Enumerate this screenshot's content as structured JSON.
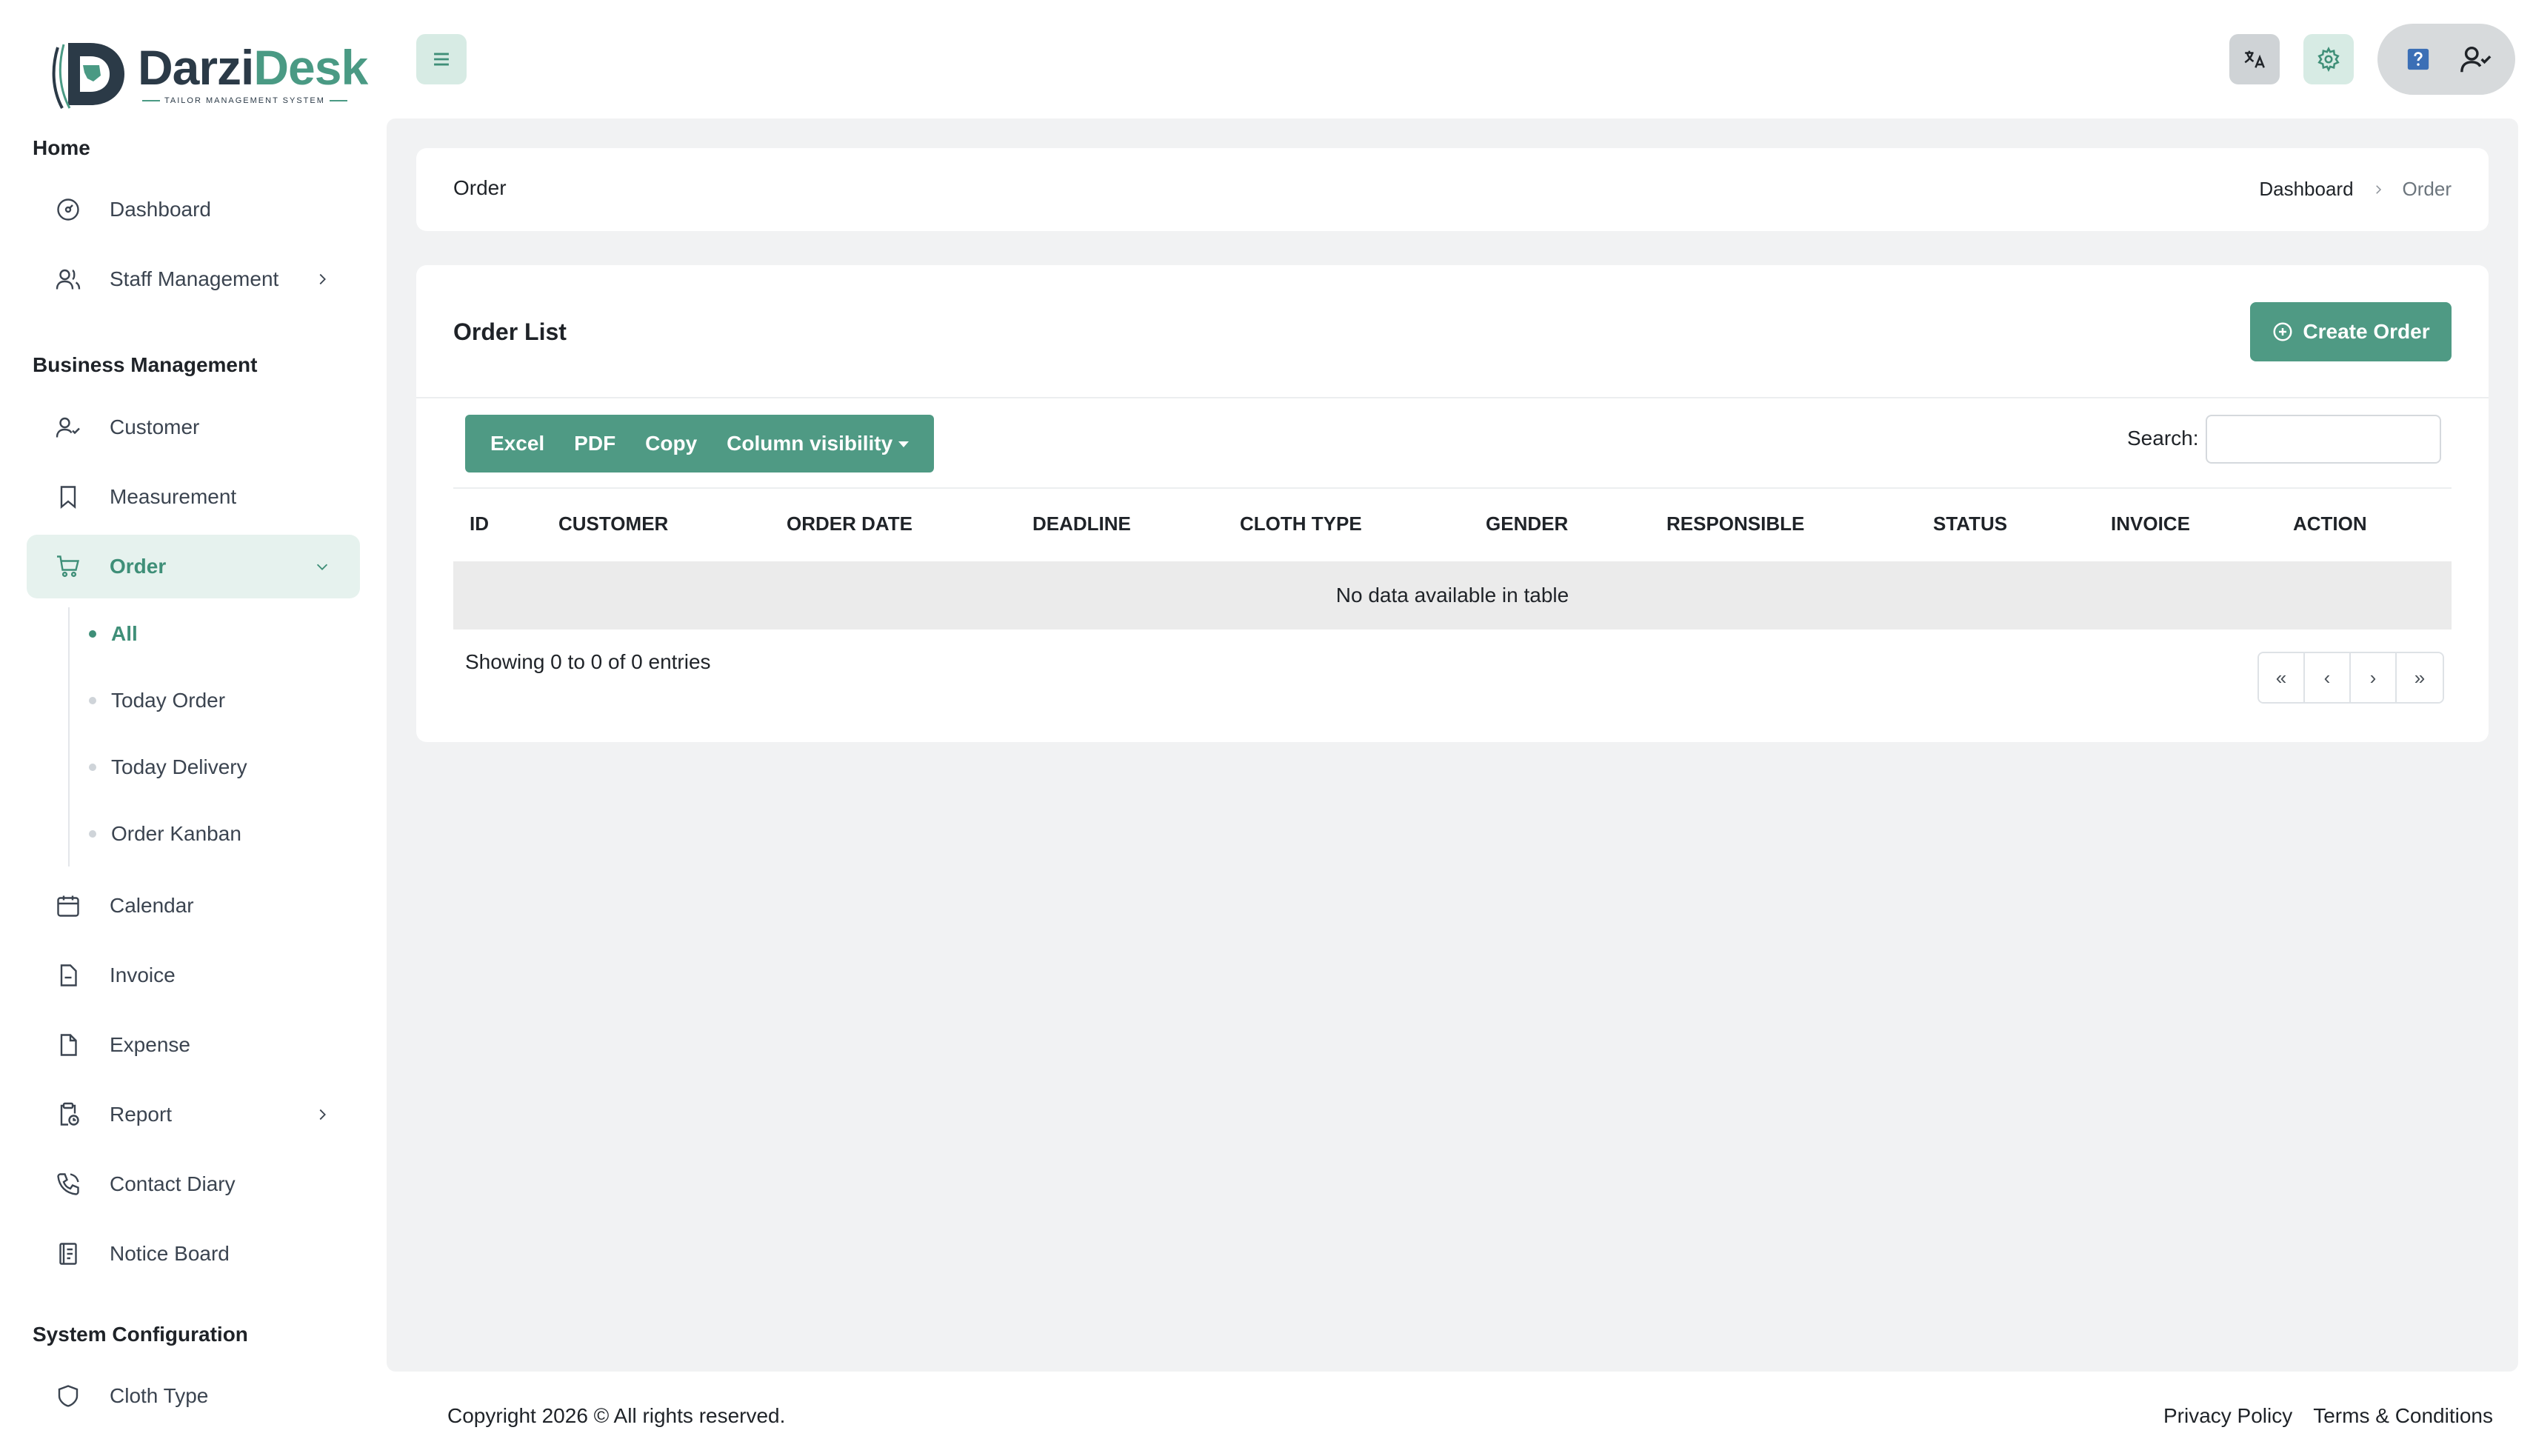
{
  "brand": {
    "word_a": "Darzi",
    "word_b": "Desk",
    "tagline": "TAILOR MANAGEMENT SYSTEM"
  },
  "sidebar": {
    "sections": [
      {
        "title": "Home"
      },
      {
        "title": "Business Management"
      },
      {
        "title": "System Configuration"
      }
    ],
    "items": {
      "dashboard": "Dashboard",
      "staff": "Staff Management",
      "customer": "Customer",
      "measurement": "Measurement",
      "order": "Order",
      "calendar": "Calendar",
      "invoice": "Invoice",
      "expense": "Expense",
      "report": "Report",
      "contact_diary": "Contact Diary",
      "notice_board": "Notice Board",
      "cloth_type": "Cloth Type"
    },
    "order_sub": [
      "All",
      "Today Order",
      "Today Delivery",
      "Order Kanban"
    ]
  },
  "header": {
    "page_title": "Order",
    "breadcrumb": [
      "Dashboard",
      "Order"
    ]
  },
  "order_list": {
    "title": "Order List",
    "create_label": "Create Order",
    "toolbar": [
      "Excel",
      "PDF",
      "Copy",
      "Column visibility"
    ],
    "search_label": "Search:",
    "search_value": "",
    "columns": [
      "ID",
      "CUSTOMER",
      "ORDER DATE",
      "DEADLINE",
      "CLOTH TYPE",
      "GENDER",
      "RESPONSIBLE",
      "STATUS",
      "INVOICE",
      "ACTION"
    ],
    "empty_text": "No data available in table",
    "info_text": "Showing 0 to 0 of 0 entries",
    "pager": [
      "«",
      "‹",
      "›",
      "»"
    ]
  },
  "footer": {
    "copyright": "Copyright 2026 © All rights reserved.",
    "links": [
      "Privacy Policy",
      "Terms & Conditions"
    ]
  },
  "colors": {
    "accent": "#4f9a84",
    "accent_light": "#e6f2ee",
    "content_bg": "#f1f2f3"
  }
}
